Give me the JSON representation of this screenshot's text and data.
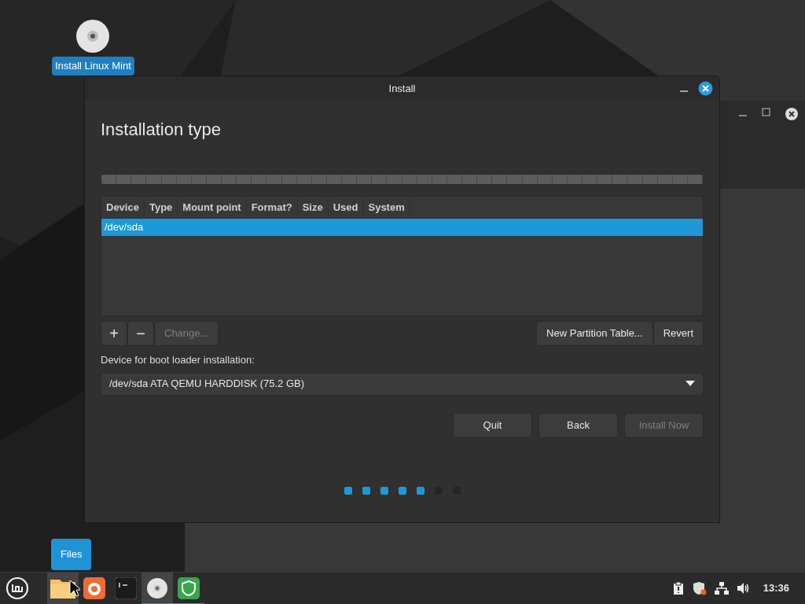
{
  "desktop_icons": [
    {
      "label": "Install Linux Mint",
      "selected": true
    }
  ],
  "dialog": {
    "title": "Install",
    "heading": "Installation type",
    "table": {
      "columns": [
        "Device",
        "Type",
        "Mount point",
        "Format?",
        "Size",
        "Used",
        "System"
      ],
      "rows": [
        {
          "device": "/dev/sda",
          "selected": true
        }
      ]
    },
    "partition_buttons": [
      {
        "label": "+",
        "disabled": false
      },
      {
        "label": "−",
        "disabled": false
      },
      {
        "label": "Change...",
        "disabled": true
      }
    ],
    "table_buttons": [
      {
        "label": "New Partition Table...",
        "disabled": false
      },
      {
        "label": "Revert",
        "disabled": false
      }
    ],
    "boot_loader": {
      "label": "Device for boot loader installation:",
      "value": "/dev/sda ATA QEMU HARDDISK (75.2 GB)"
    },
    "buttons": [
      {
        "label": "Quit",
        "disabled": false
      },
      {
        "label": "Back",
        "disabled": false
      },
      {
        "label": "Install Now",
        "disabled": true
      }
    ],
    "steps": [
      {
        "done": true
      },
      {
        "done": true
      },
      {
        "done": true
      },
      {
        "done": true
      },
      {
        "done": true
      },
      {
        "done": false
      },
      {
        "done": false
      }
    ]
  },
  "tooltip": "Files",
  "taskbar": {
    "launchers": [
      {
        "kind": "menu",
        "hovered": false,
        "running": false
      },
      {
        "kind": "folder",
        "hovered": true,
        "running": false
      },
      {
        "kind": "browser",
        "hovered": false,
        "running": false
      },
      {
        "kind": "terminal",
        "hovered": false,
        "running": false
      },
      {
        "kind": "disc",
        "hovered": true,
        "running": true
      },
      {
        "kind": "shield",
        "hovered": false,
        "running": true
      }
    ],
    "clock": "13:36"
  }
}
